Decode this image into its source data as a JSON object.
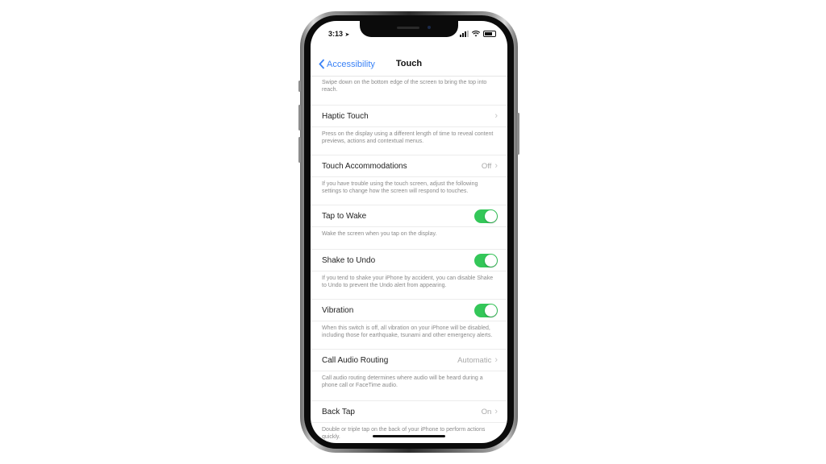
{
  "status_bar": {
    "time": "3:13",
    "location_icon": "location-arrow-icon",
    "signal_icon": "cellular-signal-icon",
    "wifi_icon": "wifi-icon",
    "battery_icon": "battery-icon"
  },
  "nav": {
    "back_label": "Accessibility",
    "title": "Touch"
  },
  "colors": {
    "accent": "#3a82f6",
    "toggle_on": "#34c759"
  },
  "top_footer": "Swipe down on the bottom edge of the screen to bring the top into reach.",
  "settings": [
    {
      "label": "Haptic Touch",
      "value": "",
      "type": "disclosure",
      "footer": "Press on the display using a different length of time to reveal content previews, actions and contextual menus."
    },
    {
      "label": "Touch Accommodations",
      "value": "Off",
      "type": "disclosure",
      "footer": "If you have trouble using the touch screen, adjust the following settings to change how the screen will respond to touches."
    },
    {
      "label": "Tap to Wake",
      "value": true,
      "type": "toggle",
      "footer": "Wake the screen when you tap on the display."
    },
    {
      "label": "Shake to Undo",
      "value": true,
      "type": "toggle",
      "footer": "If you tend to shake your iPhone by accident, you can disable Shake to Undo to prevent the Undo alert from appearing."
    },
    {
      "label": "Vibration",
      "value": true,
      "type": "toggle",
      "footer": "When this switch is off, all vibration on your iPhone will be disabled, including those for earthquake, tsunami and other emergency alerts."
    },
    {
      "label": "Call Audio Routing",
      "value": "Automatic",
      "type": "disclosure",
      "footer": "Call audio routing determines where audio will be heard during a phone call or FaceTime audio."
    },
    {
      "label": "Back Tap",
      "value": "On",
      "type": "disclosure",
      "footer": "Double or triple tap on the back of your iPhone to perform actions quickly."
    }
  ]
}
